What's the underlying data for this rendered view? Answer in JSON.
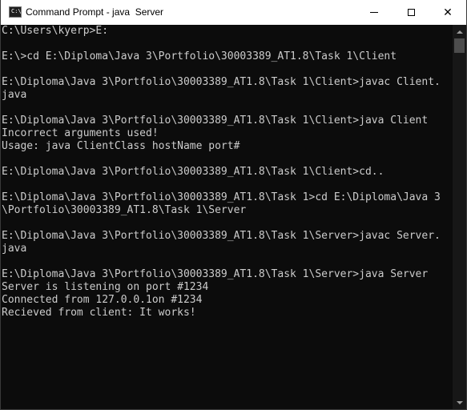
{
  "window": {
    "title": "Command Prompt - java  Server",
    "icon": "cmd-icon",
    "icon_text": "C:\\",
    "controls": [
      "minimize-icon",
      "maximize-icon",
      "close-icon"
    ],
    "close_glyph": "✕"
  },
  "console": {
    "lines": [
      "C:\\Users\\kyerp>E:",
      "",
      "E:\\>cd E:\\Diploma\\Java 3\\Portfolio\\30003389_AT1.8\\Task 1\\Client",
      "",
      "E:\\Diploma\\Java 3\\Portfolio\\30003389_AT1.8\\Task 1\\Client>javac Client.",
      "java",
      "",
      "E:\\Diploma\\Java 3\\Portfolio\\30003389_AT1.8\\Task 1\\Client>java Client",
      "Incorrect arguments used!",
      "Usage: java ClientClass hostName port#",
      "",
      "E:\\Diploma\\Java 3\\Portfolio\\30003389_AT1.8\\Task 1\\Client>cd..",
      "",
      "E:\\Diploma\\Java 3\\Portfolio\\30003389_AT1.8\\Task 1>cd E:\\Diploma\\Java 3",
      "\\Portfolio\\30003389_AT1.8\\Task 1\\Server",
      "",
      "E:\\Diploma\\Java 3\\Portfolio\\30003389_AT1.8\\Task 1\\Server>javac Server.",
      "java",
      "",
      "E:\\Diploma\\Java 3\\Portfolio\\30003389_AT1.8\\Task 1\\Server>java Server",
      "Server is listening on port #1234",
      "Connected from 127.0.0.1on #1234",
      "Recieved from client: It works!"
    ]
  },
  "colors": {
    "background": "#0c0c0c",
    "text": "#cccccc",
    "titlebar": "#ffffff"
  }
}
